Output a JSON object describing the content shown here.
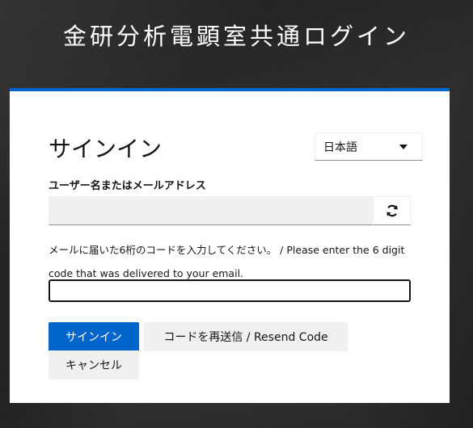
{
  "header": {
    "title": "金研分析電顕室共通ログイン"
  },
  "card": {
    "title": "サインイン",
    "accent_color": "#0066cc"
  },
  "language_select": {
    "selected": "日本語"
  },
  "username": {
    "label": "ユーザー名またはメールアドレス",
    "value": "",
    "refresh_icon": "refresh-icon"
  },
  "otp": {
    "label": "メールに届いた6桁のコードを入力してください。 / Please enter the 6 digit code that was delivered to your email.",
    "value": ""
  },
  "buttons": {
    "sign_in": "サインイン",
    "resend": "コードを再送信 / Resend Code",
    "cancel": "キャンセル"
  }
}
